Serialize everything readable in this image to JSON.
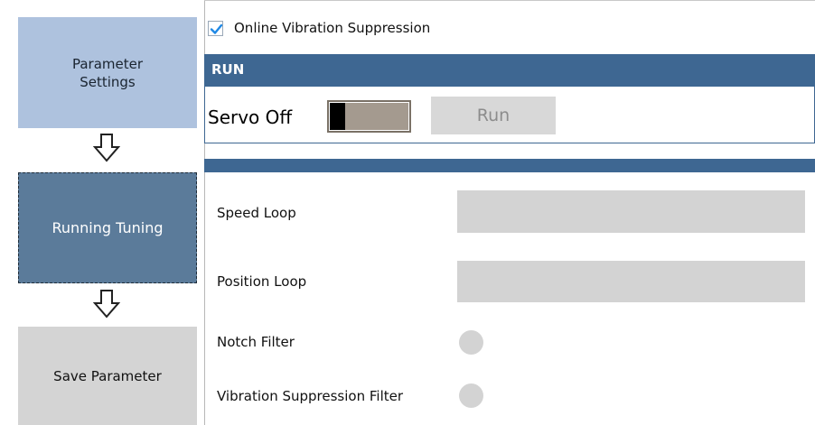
{
  "wizard": {
    "steps": [
      {
        "line1": "Parameter",
        "line2": "Settings",
        "state": "completed"
      },
      {
        "label": "Running Tuning",
        "state": "active"
      },
      {
        "label": "Save Parameter",
        "state": "pending"
      }
    ],
    "arrow_icon": "down-arrow-outline-icon"
  },
  "options": {
    "online_vibration_suppression": {
      "label": "Online Vibration Suppression",
      "checked": true
    }
  },
  "run_panel": {
    "title": "RUN",
    "servo_status": "Servo Off",
    "servo_on": false,
    "run_button": "Run"
  },
  "tuning": {
    "rows": [
      {
        "label": "Speed Loop",
        "type": "field",
        "value": ""
      },
      {
        "label": "Position Loop",
        "type": "field",
        "value": ""
      },
      {
        "label": "Notch Filter",
        "type": "indicator",
        "active": false
      },
      {
        "label": "Vibration Suppression Filter",
        "type": "indicator",
        "active": false
      }
    ]
  },
  "colors": {
    "panel_header": "#3e6792",
    "step_completed": "#aec2de",
    "step_active": "#5b7b9a",
    "step_pending": "#d4d4d4",
    "checkbox_tick": "#1e88e5",
    "toggle_track": "#a49a8f",
    "disabled": "#d3d3d3"
  }
}
